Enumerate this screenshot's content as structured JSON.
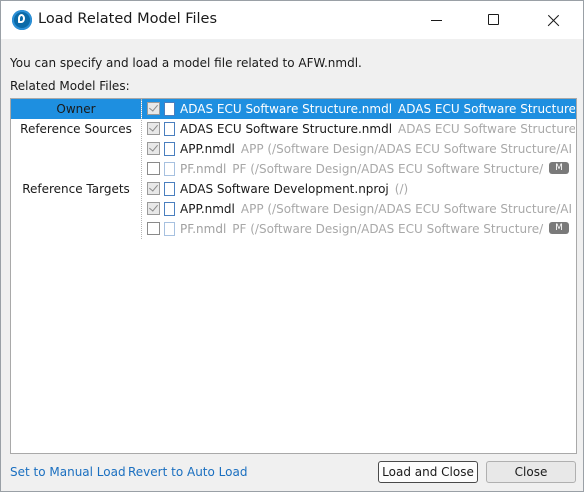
{
  "window": {
    "title": "Load Related Model Files"
  },
  "intro": {
    "description": "You can specify and load a model file related to AFW.nmdl.",
    "related_label": "Related Model Files:"
  },
  "categories": [
    {
      "label": "Owner",
      "selected": true
    },
    {
      "label": "Reference Sources",
      "selected": false
    },
    {
      "label": "Reference Targets",
      "selected": false
    }
  ],
  "rows": [
    {
      "checked": true,
      "name": "ADAS ECU Software Structure.nmdl",
      "path": "ADAS ECU Software Structure",
      "faded": false,
      "selected": true,
      "badge": ""
    },
    {
      "checked": true,
      "name": "ADAS ECU Software Structure.nmdl",
      "path": "ADAS ECU Software Structure",
      "faded": false,
      "selected": false,
      "badge": ""
    },
    {
      "checked": true,
      "name": "APP.nmdl",
      "path": "APP (/Software Design/ADAS ECU Software Structure/AI",
      "faded": false,
      "selected": false,
      "badge": ""
    },
    {
      "checked": false,
      "name": "PF.nmdl",
      "path": "PF (/Software Design/ADAS ECU Software Structure/",
      "faded": true,
      "selected": false,
      "badge": "M"
    },
    {
      "checked": true,
      "name": "ADAS Software Development.nproj",
      "path": "(/)",
      "faded": false,
      "selected": false,
      "badge": ""
    },
    {
      "checked": true,
      "name": "APP.nmdl",
      "path": "APP (/Software Design/ADAS ECU Software Structure/AI",
      "faded": false,
      "selected": false,
      "badge": ""
    },
    {
      "checked": false,
      "name": "PF.nmdl",
      "path": "PF (/Software Design/ADAS ECU Software Structure/",
      "faded": true,
      "selected": false,
      "badge": "M"
    }
  ],
  "footer": {
    "manual_link": "Set to Manual Load",
    "auto_link": "Revert to Auto Load",
    "load_close_label": "Load and Close",
    "close_label": "Close"
  }
}
